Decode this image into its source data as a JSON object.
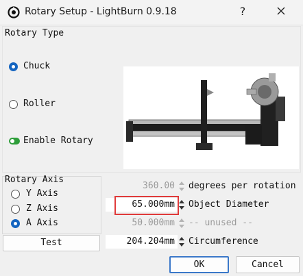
{
  "window": {
    "title": "Rotary Setup - LightBurn 0.9.18",
    "help_label": "?"
  },
  "rotary_type": {
    "heading": "Rotary Type",
    "options": [
      {
        "label": "Chuck",
        "checked": true
      },
      {
        "label": "Roller",
        "checked": false
      }
    ],
    "enable_rotary": {
      "label": "Enable Rotary",
      "on": true
    }
  },
  "rotary_axis": {
    "heading": "Rotary Axis",
    "options": [
      {
        "label": "Y Axis",
        "checked": false
      },
      {
        "label": "Z Axis",
        "checked": false
      },
      {
        "label": "A Axis",
        "checked": true
      }
    ],
    "test_label": "Test"
  },
  "fields": {
    "degrees": {
      "value": "360.00",
      "label": "degrees per rotation",
      "enabled": false
    },
    "diameter": {
      "value": "65.000mm",
      "label": "Object Diameter",
      "enabled": true
    },
    "unused": {
      "value": "50.000mm",
      "label": "-- unused --",
      "enabled": false
    },
    "circumference": {
      "value": "204.204mm",
      "label": "Circumference",
      "enabled": true
    }
  },
  "buttons": {
    "ok_label": "OK",
    "cancel_label": "Cancel"
  },
  "colors": {
    "accent": "#1565c0",
    "toggle_on": "#2e9e3a",
    "highlight": "#e03a3a"
  }
}
